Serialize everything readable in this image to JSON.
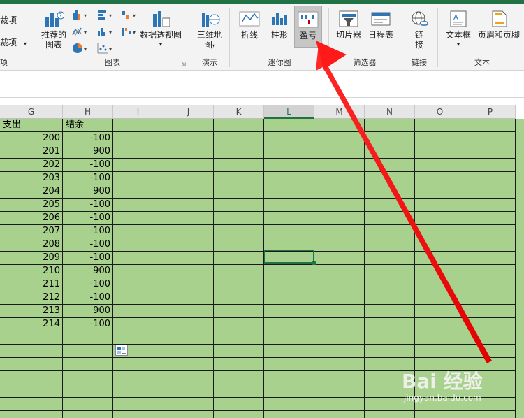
{
  "ribbon": {
    "left_partial": {
      "item1": "裁项",
      "item2": "裁项",
      "label": "项"
    },
    "charts": {
      "recommended": "推荐的\n图表",
      "pivot_chart": "数据透视图",
      "label": "图表"
    },
    "tours": {
      "map3d": "三维地\n图",
      "label": "演示"
    },
    "sparklines": {
      "line": "折线",
      "column": "柱形",
      "winloss": "盈亏",
      "label": "迷你图"
    },
    "filters": {
      "slicer": "切片器",
      "timeline": "日程表",
      "label": "筛选器"
    },
    "links": {
      "link": "链\n接",
      "label": "链接"
    },
    "text": {
      "textbox": "文本框",
      "header_footer": "页眉和页脚",
      "label": "文本"
    }
  },
  "columns": [
    "G",
    "H",
    "I",
    "J",
    "K",
    "L",
    "M",
    "N",
    "O",
    "P"
  ],
  "active_column": "L",
  "table": {
    "headers": [
      "支出",
      "结余"
    ],
    "rows": [
      [
        "200",
        "-100"
      ],
      [
        "201",
        "900"
      ],
      [
        "202",
        "-100"
      ],
      [
        "203",
        "-100"
      ],
      [
        "204",
        "900"
      ],
      [
        "205",
        "-100"
      ],
      [
        "206",
        "-100"
      ],
      [
        "207",
        "-100"
      ],
      [
        "208",
        "-100"
      ],
      [
        "209",
        "-100"
      ],
      [
        "210",
        "900"
      ],
      [
        "211",
        "-100"
      ],
      [
        "212",
        "-100"
      ],
      [
        "213",
        "900"
      ],
      [
        "214",
        "-100"
      ]
    ]
  },
  "watermark": {
    "brand": "Bai 经验",
    "url": "jingyan.baidu.com"
  },
  "colors": {
    "sheet_bg": "#a9d18e",
    "accent": "#217346",
    "arrow": "#ff0000"
  }
}
